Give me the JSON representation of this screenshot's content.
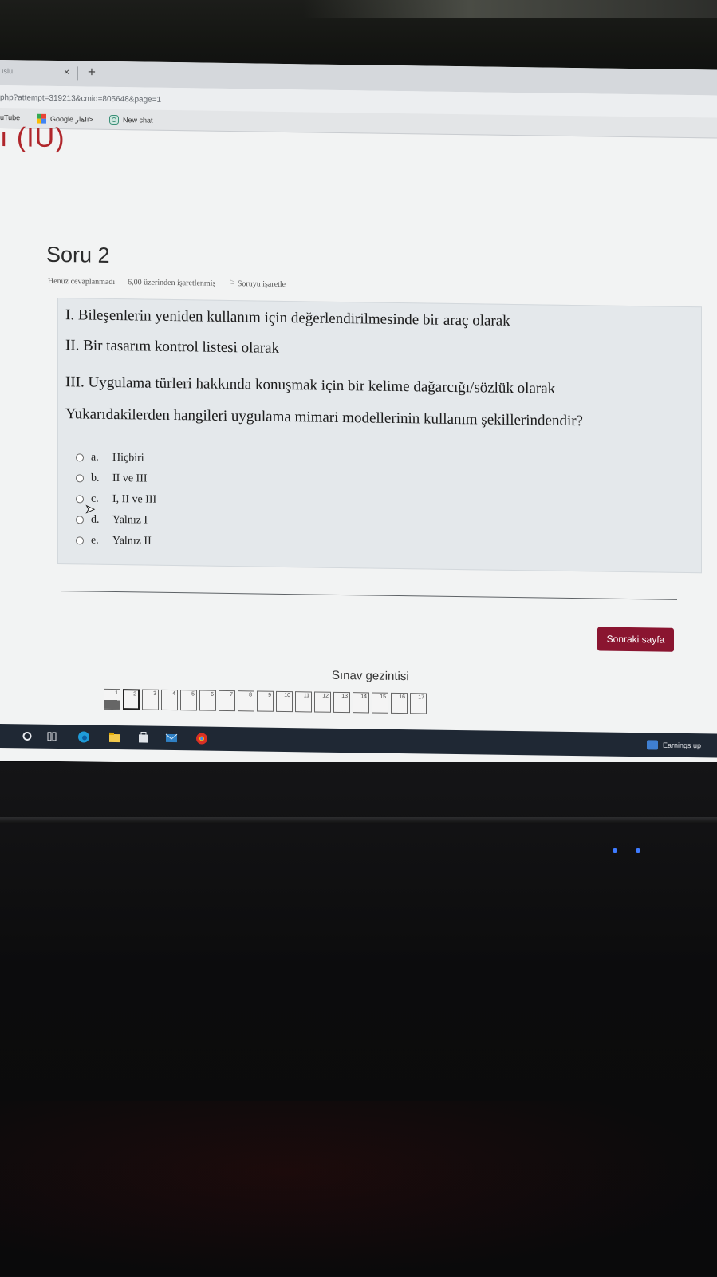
{
  "browser": {
    "tab_title": "ıslü",
    "tab_close": "×",
    "tab_new": "+",
    "url": "php?attempt=319213&cmid=805648&page=1",
    "bookmarks": [
      {
        "label": "uTube",
        "icon": "youtube-icon"
      },
      {
        "label": "Google ھارIı>",
        "icon": "google-maps-icon"
      },
      {
        "label": "New chat",
        "icon": "chat-icon"
      }
    ]
  },
  "page": {
    "heading_fragment": "ı (IU)"
  },
  "question": {
    "title": "Soru 2",
    "status": "Henüz cevaplanmadı",
    "points": "6,00 üzerinden işaretlenmiş",
    "flag_label": "Soruyu işaretle",
    "lines": [
      "I. Bileşenlerin yeniden kullanım için değerlendirilmesinde bir araç olarak",
      "II. Bir tasarım kontrol listesi olarak",
      "III. Uygulama türleri hakkında konuşmak için bir kelime dağarcığı/sözlük olarak",
      "Yukarıdakilerden hangileri uygulama mimari modellerinin kullanım şekillerindendir?"
    ],
    "answers": [
      {
        "letter": "a.",
        "text": "Hiçbiri"
      },
      {
        "letter": "b.",
        "text": "II ve III"
      },
      {
        "letter": "c.",
        "text": "I, II ve III"
      },
      {
        "letter": "d.",
        "text": "Yalnız I"
      },
      {
        "letter": "e.",
        "text": "Yalnız II"
      }
    ]
  },
  "navigation": {
    "next_label": "Sonraki sayfa",
    "title": "Sınav gezintisi",
    "pages": [
      "1",
      "2",
      "3",
      "4",
      "5",
      "6",
      "7",
      "8",
      "9",
      "10",
      "11",
      "12",
      "13",
      "14",
      "15",
      "16",
      "17"
    ],
    "current_page": "2"
  },
  "taskbar": {
    "icons": [
      "search-icon",
      "task-view-icon",
      "edge-icon",
      "file-explorer-icon",
      "store-icon",
      "mail-icon",
      "chrome-icon"
    ],
    "news_label": "Earnings up"
  },
  "colors": {
    "accent": "#8a1530",
    "heading_red": "#b0262b",
    "taskbar": "#1f2834"
  }
}
